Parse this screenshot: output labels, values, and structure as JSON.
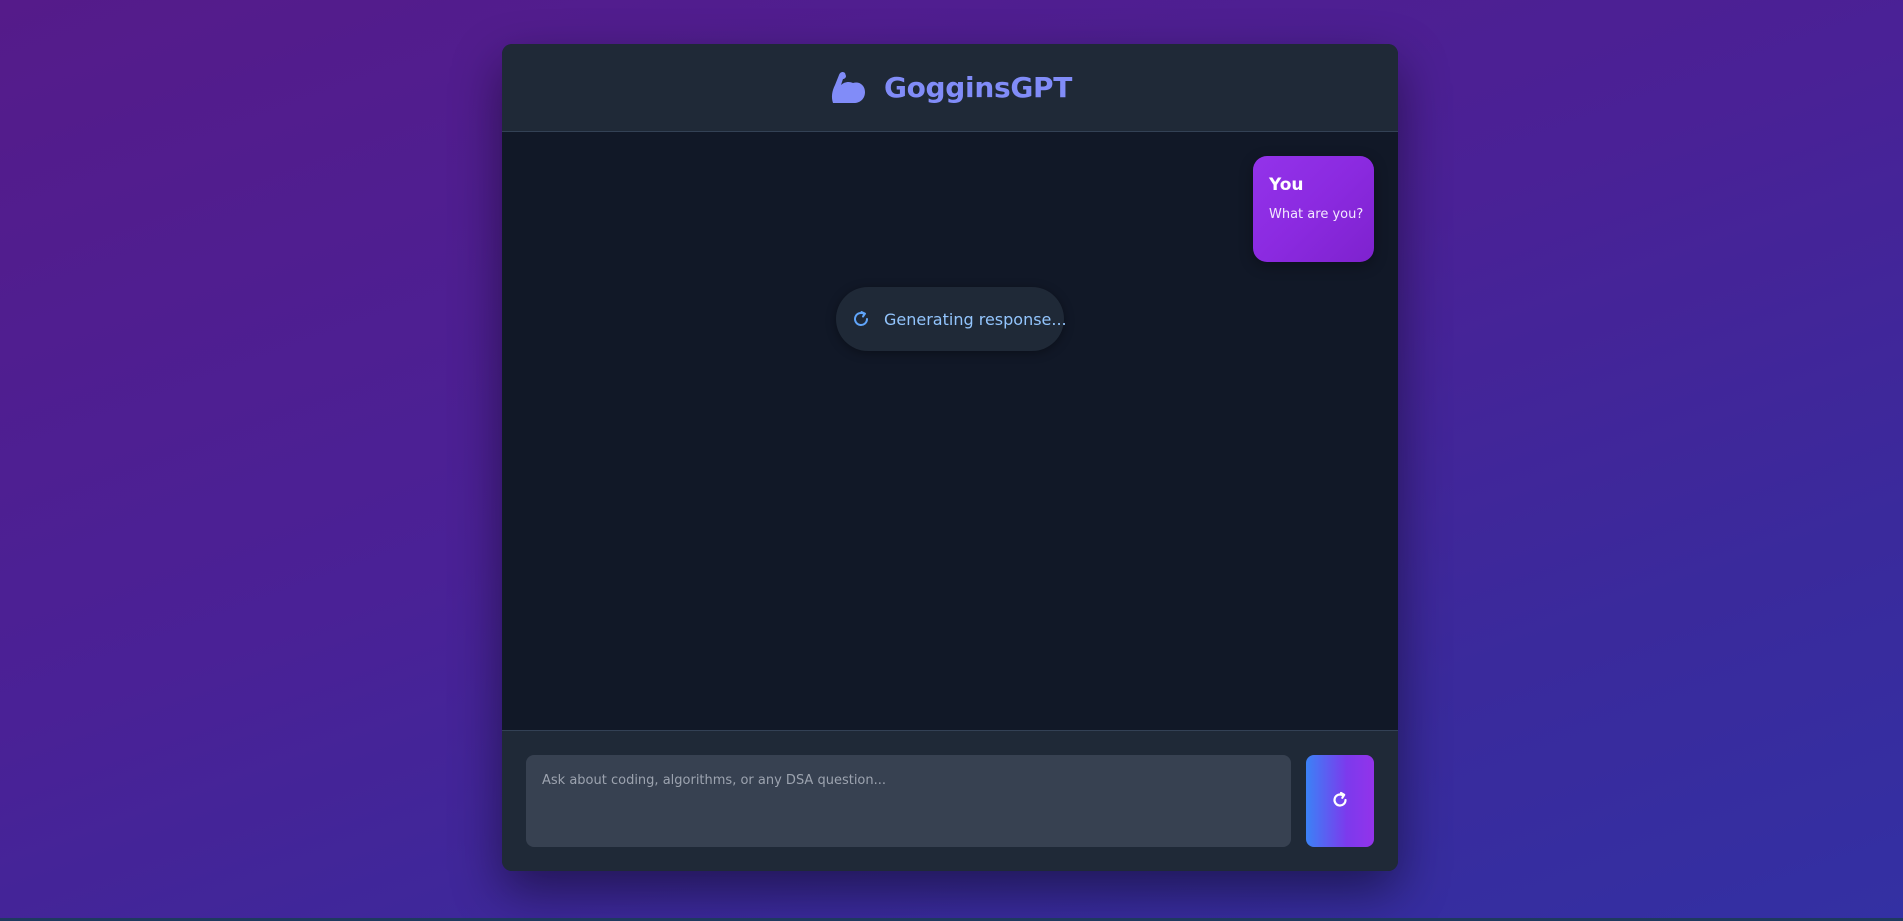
{
  "app": {
    "title": "GogginsGPT",
    "logo_icon": "flexed-biceps-icon",
    "accent_color": "#818cf8"
  },
  "messages": [
    {
      "sender": "You",
      "text": "What are you?",
      "bubble_color": "#9333ea"
    }
  ],
  "status": {
    "icon": "spinner-icon",
    "label": "Generating response..."
  },
  "composer": {
    "placeholder": "Ask about coding, algorithms, or any DSA question...",
    "value": "",
    "send_icon": "refresh-spinner-icon"
  }
}
